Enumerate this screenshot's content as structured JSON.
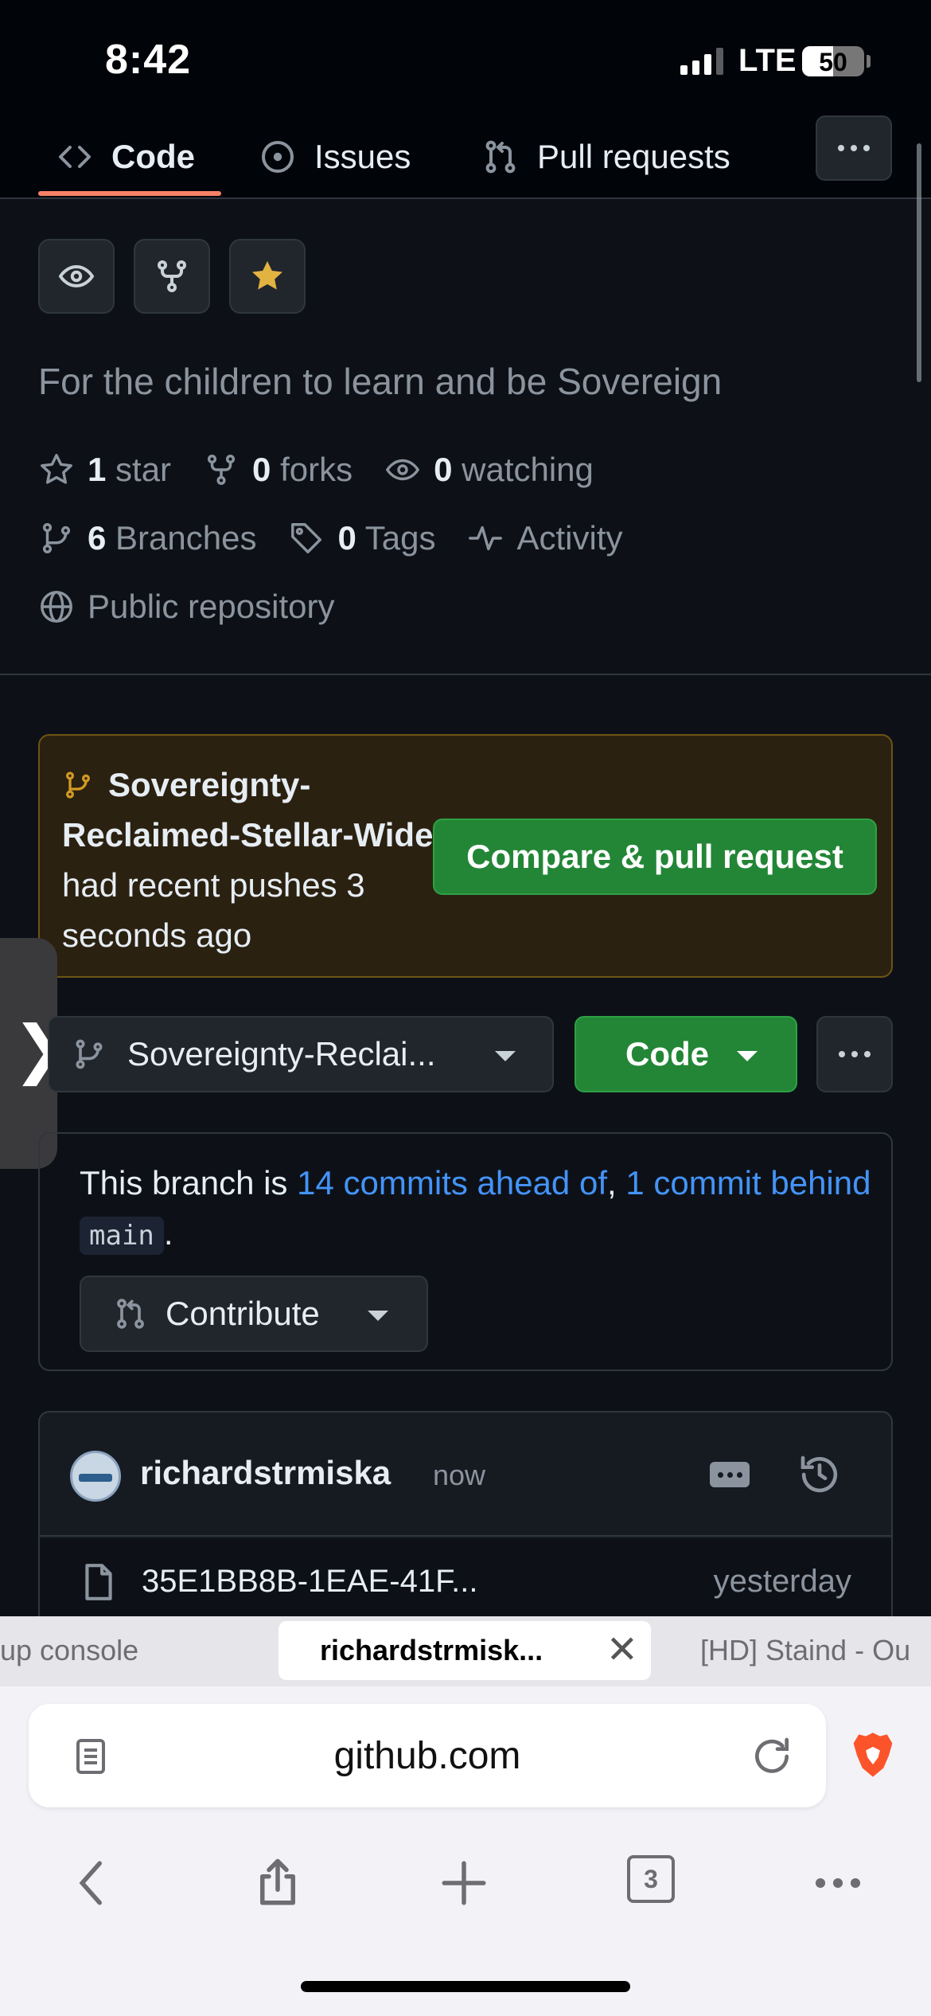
{
  "status_bar": {
    "time": "8:42",
    "network": "LTE",
    "battery": "50"
  },
  "repo_tabs": {
    "code": "Code",
    "issues": "Issues",
    "pull_requests": "Pull requests"
  },
  "repo": {
    "description": "For the children to learn and be Sovereign",
    "stars_count": "1",
    "stars_label": "star",
    "forks_count": "0",
    "forks_label": "forks",
    "watching_count": "0",
    "watching_label": "watching",
    "branches_count": "6",
    "branches_label": "Branches",
    "tags_count": "0",
    "tags_label": "Tags",
    "activity_label": "Activity",
    "visibility": "Public repository"
  },
  "push_banner": {
    "branch": "Sovereignty-Reclaimed-Stellar-Wide",
    "message": "had recent pushes 3 seconds ago",
    "button": "Compare & pull request"
  },
  "branch_bar": {
    "selected_branch": "Sovereignty-Reclai...",
    "code_button": "Code"
  },
  "branch_status": {
    "prefix": "This branch is",
    "ahead": "14 commits ahead of",
    "separator": ",",
    "behind": "1 commit behind",
    "base": "main",
    "suffix": ".",
    "contribute": "Contribute"
  },
  "latest_commit": {
    "author": "richardstrmiska",
    "time": "now",
    "file_name": "35E1BB8B-1EAE-41F...",
    "file_time": "yesterday"
  },
  "browser": {
    "tab_left": "up console",
    "tab_active": "richardstrmisk...",
    "tab_right": "[HD] Staind - Ou",
    "url": "github.com",
    "tab_count": "3"
  },
  "colors": {
    "accent_green": "#238636",
    "link_blue": "#4493f8",
    "underline_orange": "#f78166",
    "star_yellow": "#e3b341"
  }
}
